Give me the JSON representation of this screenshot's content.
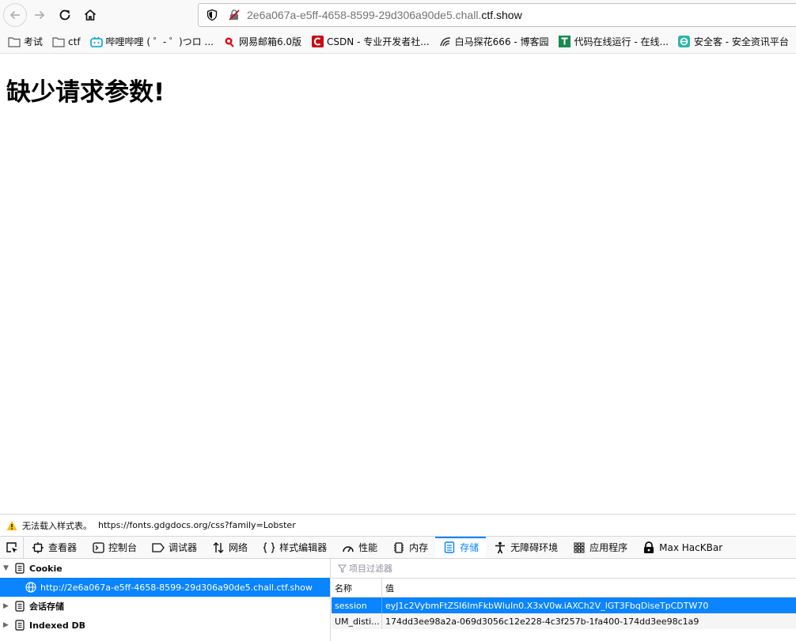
{
  "browser": {
    "url_prefix": "2e6a067a-e5ff-4658-8599-29d306a90de5.chall.",
    "url_domain": "ctf.show"
  },
  "bookmarks": [
    {
      "label": "考试",
      "icon": "folder-icon"
    },
    {
      "label": "ctf",
      "icon": "folder-icon"
    },
    {
      "label": "哔哩哔哩 ( ゜- ゜)つロ ...",
      "icon": "bilibili-icon"
    },
    {
      "label": "网易邮箱6.0版",
      "icon": "netease-icon"
    },
    {
      "label": "CSDN - 专业开发者社...",
      "icon": "csdn-icon"
    },
    {
      "label": "白马探花666 - 博客园",
      "icon": "cnblogs-icon"
    },
    {
      "label": "代码在线运行 - 在线...",
      "icon": "tool-icon"
    },
    {
      "label": "安全客 - 安全资讯平台",
      "icon": "anquanke-icon"
    }
  ],
  "page": {
    "heading": "缺少请求参数!"
  },
  "console": {
    "warning_text": "无法载入样式表。",
    "warning_url": "https://fonts.gdgdocs.org/css?family=Lobster"
  },
  "devtools": {
    "tabs": [
      {
        "label": "查看器",
        "icon": "inspector-icon"
      },
      {
        "label": "控制台",
        "icon": "console-icon"
      },
      {
        "label": "调试器",
        "icon": "debugger-icon"
      },
      {
        "label": "网络",
        "icon": "network-icon"
      },
      {
        "label": "样式编辑器",
        "icon": "style-editor-icon"
      },
      {
        "label": "性能",
        "icon": "performance-icon"
      },
      {
        "label": "内存",
        "icon": "memory-icon"
      },
      {
        "label": "存储",
        "icon": "storage-icon"
      },
      {
        "label": "无障碍环境",
        "icon": "accessibility-icon"
      },
      {
        "label": "应用程序",
        "icon": "application-icon"
      },
      {
        "label": "Max HacKBar",
        "icon": "hackbar-icon"
      }
    ],
    "active_tab": "存储",
    "tree": {
      "cookie": "Cookie",
      "cookie_host": "http://2e6a067a-e5ff-4658-8599-29d306a90de5.chall.ctf.show",
      "session_storage": "会话存储",
      "indexed_db": "Indexed DB"
    },
    "filter_placeholder": "项目过滤器",
    "columns": {
      "name": "名称",
      "value": "值"
    },
    "rows": [
      {
        "name": "session",
        "value": "eyJ1c2VybmFtZSI6ImFkbWluIn0.X3xV0w.iAXCh2V_lGT3FbqDiseTpCDTW70"
      },
      {
        "name": "UM_disti...",
        "value": "174dd3ee98a2a-069d3056c12e228-4c3f257b-1fa400-174dd3ee98c1a9"
      }
    ],
    "accent_color": "#0a84ff"
  }
}
